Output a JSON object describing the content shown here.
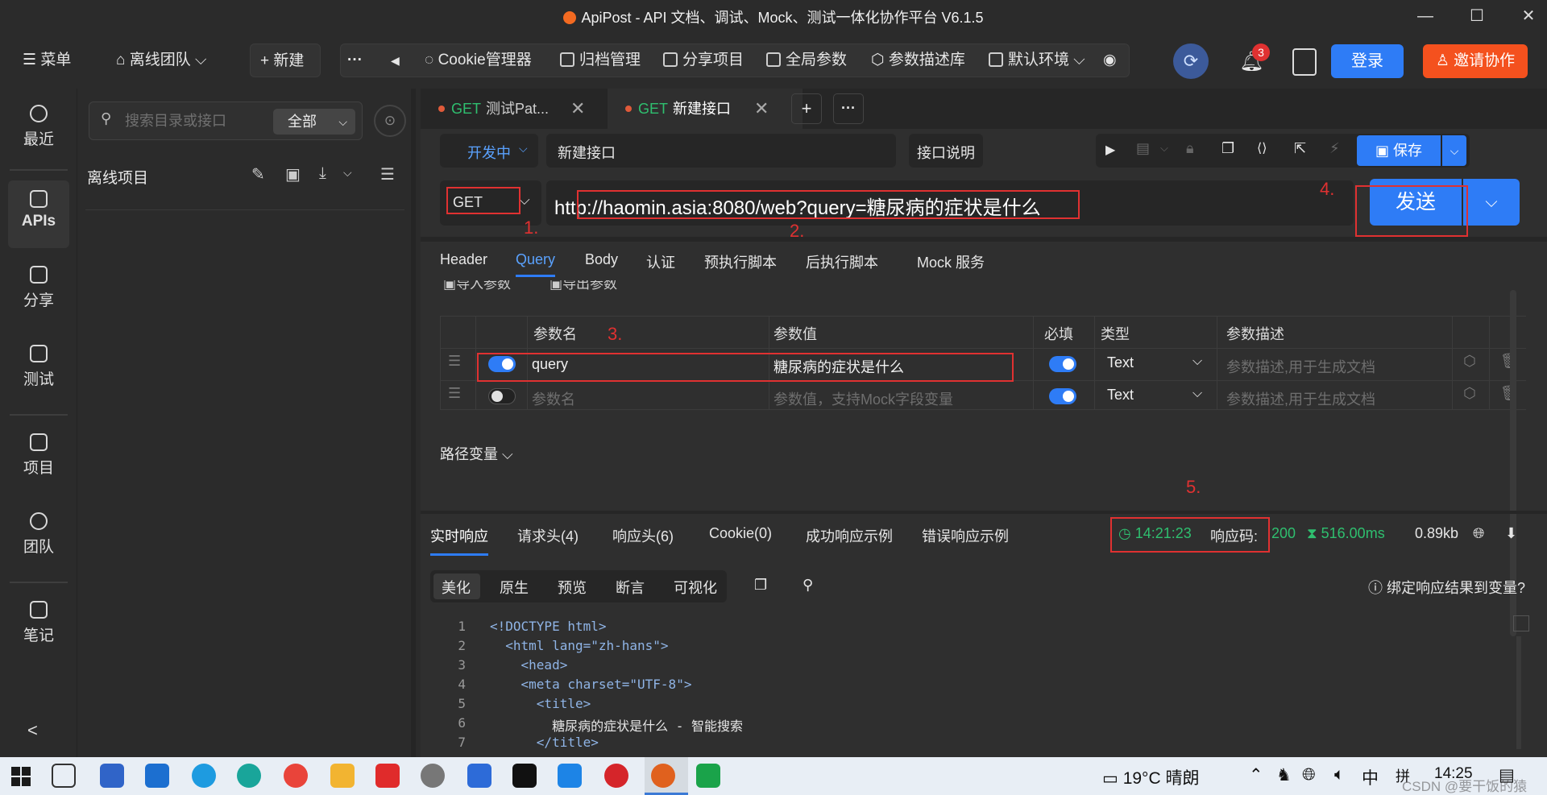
{
  "window": {
    "title": "ApiPost - API 文档、调试、Mock、测试一体化协作平台 V6.1.5",
    "controls": [
      "—",
      "☐",
      "✕"
    ]
  },
  "toolbar": {
    "menu_label": "菜单",
    "team_label": "离线团队",
    "new_label": "新建",
    "more_glyph": "···",
    "back_glyph": "◀",
    "items": [
      "Cookie管理器",
      "归档管理",
      "分享项目",
      "全局参数",
      "参数描述库",
      "默认环境"
    ],
    "notification_count": "3",
    "login_label": "登录",
    "invite_label": "邀请协作"
  },
  "leftnav": {
    "items": [
      "最近",
      "APIs",
      "分享",
      "测试",
      "项目",
      "团队",
      "笔记"
    ],
    "collapse_glyph": "<"
  },
  "tree": {
    "search_placeholder": "搜索目录或接口",
    "scope": "全部",
    "project_title": "离线项目"
  },
  "tabs": [
    {
      "method": "GET",
      "label": "测试Pat...",
      "close": "✕"
    },
    {
      "method": "GET",
      "label": "新建接口",
      "close": "✕"
    }
  ],
  "tabs_extra": {
    "add": "+",
    "more": "···"
  },
  "request": {
    "status": "开发中",
    "name": "新建接口",
    "doc_label": "接口说明",
    "save_label": "保存",
    "method": "GET",
    "url": "http://haomin.asia:8080/web?query=糖尿病的症状是什么",
    "send_label": "发送"
  },
  "annotations": [
    "1.",
    "2.",
    "3.",
    "4.",
    "5."
  ],
  "param_tabs": [
    "Header",
    "Query",
    "Body",
    "认证",
    "预执行脚本",
    "后执行脚本",
    "Mock 服务"
  ],
  "param_actions": [
    "导入参数",
    "导出参数"
  ],
  "param_table": {
    "headers": [
      "参数名",
      "参数值",
      "必填",
      "类型",
      "参数描述"
    ],
    "rows": [
      {
        "enabled": true,
        "name": "query",
        "value": "糖尿病的症状是什么",
        "required": true,
        "type": "Text",
        "desc": "参数描述,用于生成文档"
      },
      {
        "enabled": false,
        "name": "参数名",
        "value": "参数值，支持Mock字段变量",
        "required": true,
        "type": "Text",
        "desc": "参数描述,用于生成文档"
      }
    ]
  },
  "path_vars_label": "路径变量",
  "response": {
    "tabs": [
      "实时响应",
      "请求头(4)",
      "响应头(6)",
      "Cookie(0)",
      "成功响应示例",
      "错误响应示例"
    ],
    "time": "14:21:23",
    "code_label": "响应码:",
    "code": "200",
    "duration": "516.00ms",
    "size": "0.89kb",
    "view_modes": [
      "美化",
      "原生",
      "预览",
      "断言",
      "可视化"
    ],
    "bind_label": "绑定响应结果到变量?",
    "code_lines": [
      {
        "n": "1",
        "text": "<!DOCTYPE html>"
      },
      {
        "n": "2",
        "text": "  <html lang=\"zh-hans\">"
      },
      {
        "n": "3",
        "text": "    <head>"
      },
      {
        "n": "4",
        "text": "    <meta charset=\"UTF-8\">"
      },
      {
        "n": "5",
        "text": "      <title>"
      },
      {
        "n": "6",
        "text": "        糖尿病的症状是什么 - 智能搜索"
      },
      {
        "n": "7",
        "text": "      </title>"
      }
    ]
  },
  "taskbar": {
    "weather": "19°C  晴朗",
    "ime": "中",
    "ime2": "拼",
    "clock": "14:25",
    "watermark": "CSDN @要干饭的猿"
  },
  "colors": {
    "accent": "#2e7cf6",
    "invite": "#f4511e",
    "annotation": "#e03131",
    "success": "#2fbf6f"
  }
}
